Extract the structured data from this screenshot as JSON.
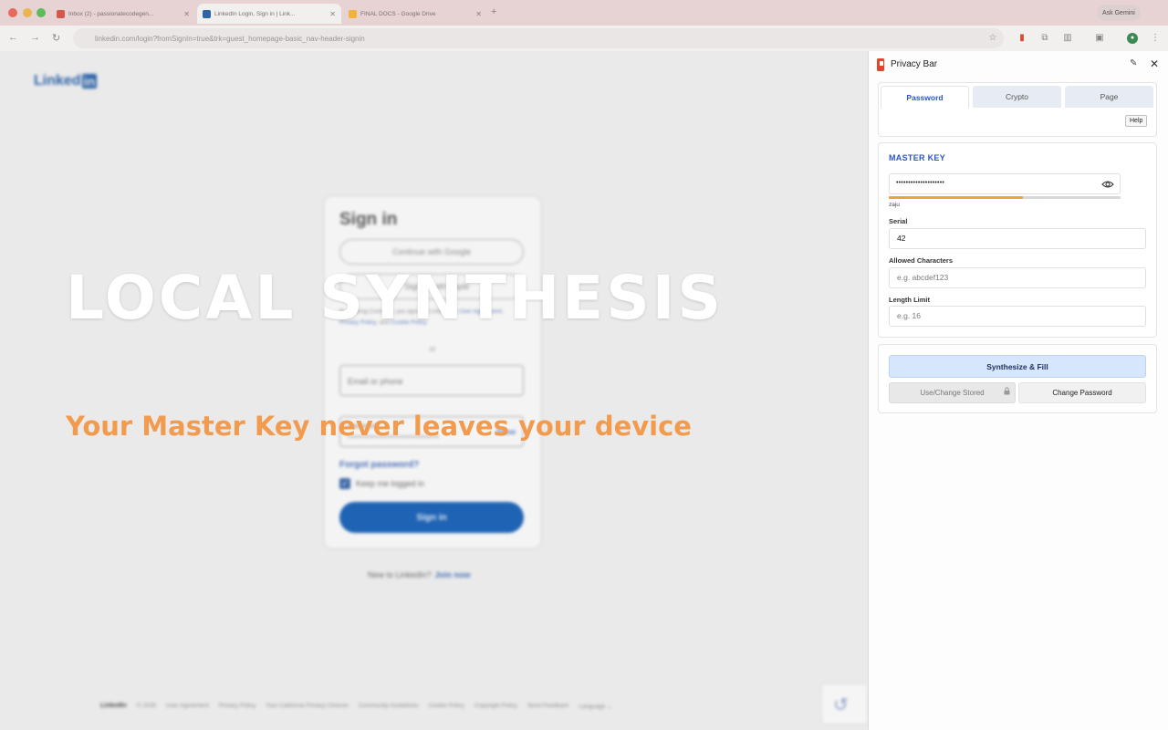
{
  "browser": {
    "tabs": [
      {
        "title": "Inbox (2) - passionatecodegen...",
        "favicon_color": "#d6584a"
      },
      {
        "title": "LinkedIn Login, Sign in | Link...",
        "favicon_color": "#2d64a8"
      },
      {
        "title": "FINAL DOCS - Google Drive",
        "favicon_color": "#f2b33a"
      }
    ],
    "new_tab_symbol": "+",
    "gemini_label": "Ask Gemini",
    "url": "linkedin.com/login?fromSignIn=true&trk=guest_homepage-basic_nav-header-signin"
  },
  "linkedin": {
    "logo_text": "Linked",
    "logo_in": "in",
    "heading": "Sign in",
    "google_button": "Continue with Google",
    "apple_button": "Sign in with Apple",
    "terms_prefix": "By clicking Continue, you agree to LinkedIn's",
    "terms_user_agreement": "User Agreement",
    "terms_privacy": "Privacy Policy",
    "terms_and": ", and",
    "terms_cookie": "Cookie Policy",
    "or_label": "or",
    "email_label": "Email or phone",
    "password_label": "Password",
    "password_dots": "••••••••••••••••••••••••••••••••••",
    "show_label": "Show",
    "forgot_label": "Forgot password?",
    "keep_logged_in": "Keep me logged in",
    "signin_button": "Sign in",
    "new_to": "New to LinkedIn?",
    "join_now": "Join now",
    "footer": {
      "logo": "LinkedIn",
      "copyright": "© 2026",
      "links": [
        "User Agreement",
        "Privacy Policy",
        "Your California Privacy Choices",
        "Community Guidelines",
        "Cookie Policy",
        "Copyright Policy",
        "Send Feedback",
        "Language ⌄"
      ]
    }
  },
  "overlay": {
    "title": "LOCAL SYNTHESIS",
    "subtitle": "Your Master Key never leaves your device"
  },
  "panel": {
    "title": "Privacy Bar",
    "tabs": [
      "Password",
      "Crypto",
      "Page"
    ],
    "active_tab": "Password",
    "help_label": "Help",
    "master_key_heading": "MASTER KEY",
    "master_key_value": "••••••••••••••••••••",
    "strength_fraction": 0.58,
    "strength_color": "#f0a23a",
    "hint": "zaju",
    "serial_label": "Serial",
    "serial_value": "42",
    "allowed_label": "Allowed Characters",
    "allowed_placeholder": "e.g. abcdef123",
    "length_label": "Length Limit",
    "length_placeholder": "e.g. 16",
    "synth_button": "Synthesize & Fill",
    "use_stored_button": "Use/Change Stored",
    "change_password_button": "Change Password",
    "accent_color": "#2a56c6"
  }
}
